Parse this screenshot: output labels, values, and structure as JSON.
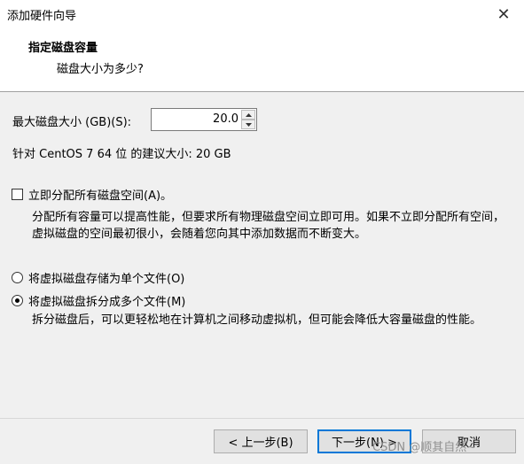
{
  "window": {
    "title": "添加硬件向导",
    "close_icon": "close-icon"
  },
  "header": {
    "title": "指定磁盘容量",
    "subtitle": "磁盘大小为多少?"
  },
  "disk_size": {
    "label": "最大磁盘大小 (GB)(S):",
    "value": "20.0",
    "recommendation": "针对 CentOS 7 64 位 的建议大小: 20 GB"
  },
  "allocate": {
    "label": "立即分配所有磁盘空间(A)。",
    "checked": false,
    "description": "分配所有容量可以提高性能，但要求所有物理磁盘空间立即可用。如果不立即分配所有空间，虚拟磁盘的空间最初很小，会随着您向其中添加数据而不断变大。"
  },
  "storage_options": [
    {
      "label": "将虚拟磁盘存储为单个文件(O)",
      "selected": false
    },
    {
      "label": "将虚拟磁盘拆分成多个文件(M)",
      "selected": true
    }
  ],
  "split_description": "拆分磁盘后，可以更轻松地在计算机之间移动虚拟机，但可能会降低大容量磁盘的性能。",
  "buttons": {
    "back": "< 上一步(B)",
    "next": "下一步(N) >",
    "cancel": "取消"
  },
  "watermark": "CSDN @顺其自然~"
}
